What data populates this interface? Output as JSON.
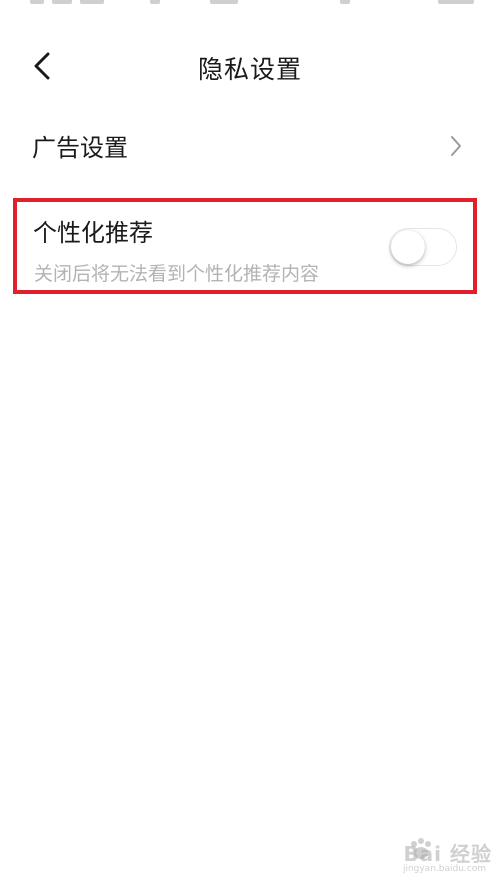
{
  "header": {
    "title": "隐私设置"
  },
  "settings": {
    "ad_settings_label": "广告设置",
    "personalized": {
      "title": "个性化推荐",
      "description": "关闭后将无法看到个性化推荐内容",
      "enabled": false
    }
  },
  "colors": {
    "highlight_border": "#e0202a",
    "description_text": "#b3b3b3",
    "title_text": "#1a1a1a"
  },
  "watermark": {
    "text": "Bai 经验",
    "sub": "jingyan.baidu.com"
  },
  "icons": {
    "back": "back-chevron-icon",
    "row_arrow": "chevron-right-icon",
    "watermark_logo": "paw-logo-icon"
  }
}
